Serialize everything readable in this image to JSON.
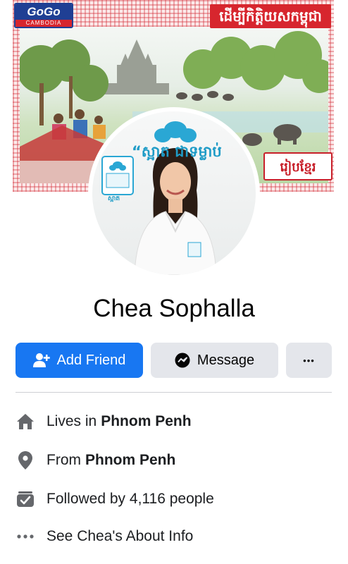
{
  "cover": {
    "badge_title": "GoGo",
    "badge_subtitle": "CAMBODIA",
    "banner_text": "ដើម្បីកិត្តិយសកម្ពុជា",
    "right_text": "រៀបខ្មែរ"
  },
  "avatar": {
    "slogan": "“ស្អាត ជាទម្លាប់",
    "brand_label": "ស្អាត"
  },
  "profile": {
    "name": "Chea Sophalla"
  },
  "actions": {
    "add_friend_label": "Add Friend",
    "message_label": "Message",
    "more_label": "•••"
  },
  "info": {
    "lives_prefix": "Lives in",
    "lives_value": "Phnom Penh",
    "from_prefix": "From",
    "from_value": "Phnom Penh",
    "followers_text": "Followed by 4,116 people",
    "about_text": "See Chea's About Info"
  },
  "icons": {
    "home": "home-icon",
    "location": "location-pin-icon",
    "followers": "followers-icon",
    "more": "more-dots-icon",
    "add_friend": "add-friend-icon",
    "messenger": "messenger-icon"
  },
  "colors": {
    "primary": "#1877f2",
    "secondary_button": "#e4e6eb",
    "text": "#1c1e21",
    "icon_gray": "#65676b"
  }
}
